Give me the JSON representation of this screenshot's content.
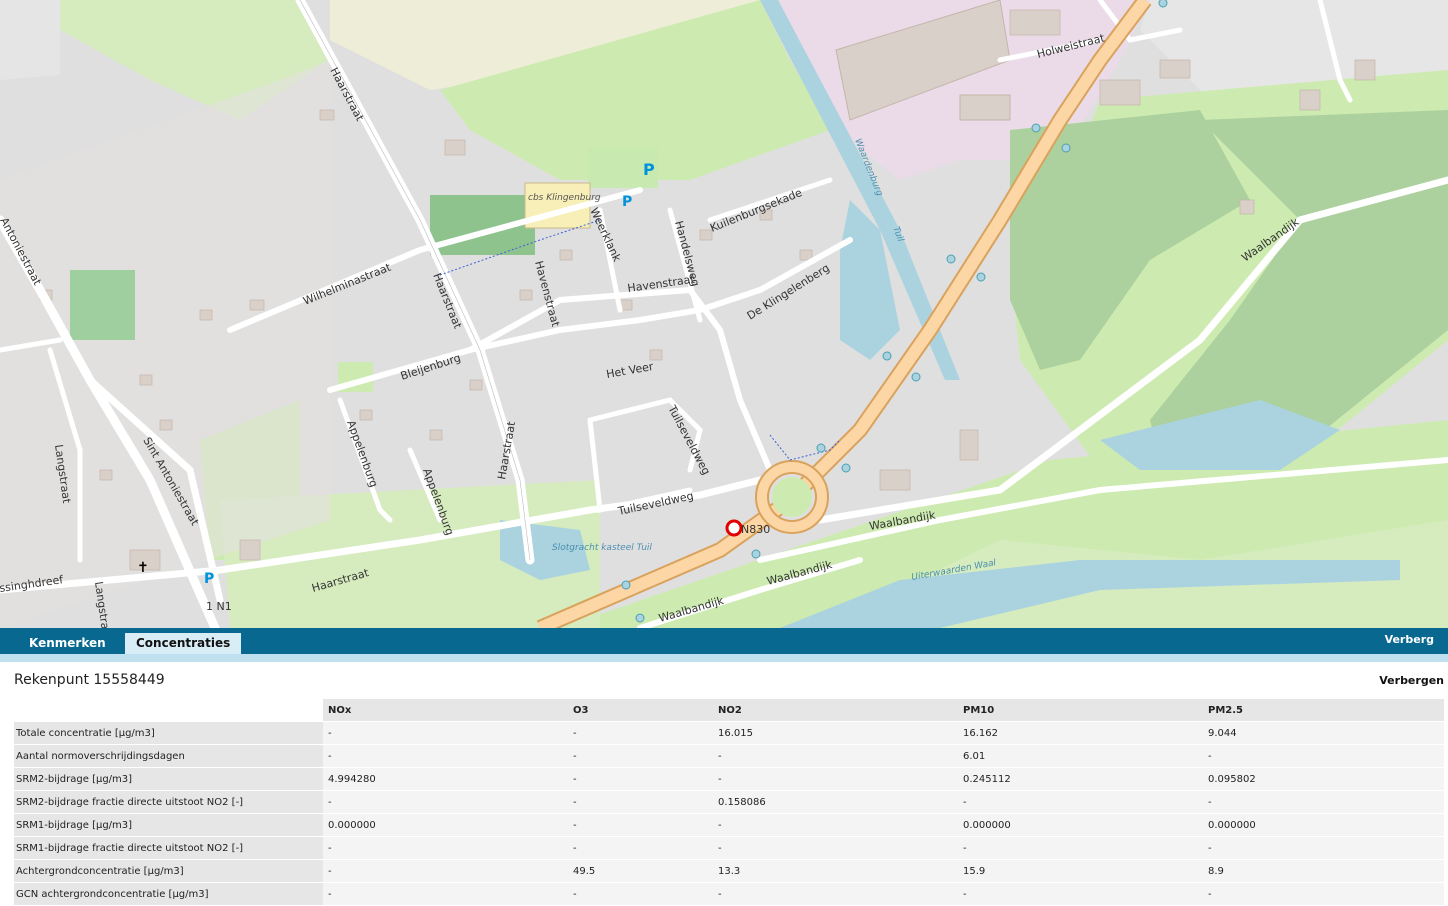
{
  "map": {
    "labels": {
      "haarstraat": "Haarstraat",
      "wilhelminastraat": "Wilhelminastraat",
      "havenstraat_v": "Havenstraat",
      "havenstraat_h": "Havenstraat",
      "bleijenburg": "Bleijenburg",
      "appelenburg1": "Appelenburg",
      "appelenburg2": "Appelenburg",
      "het_veer": "Het Veer",
      "tuilseveldweg1": "Tuilseveldweg",
      "tuilseveldweg2": "Tuilseveldweg",
      "kuilenburgsekade": "Kuilenburgsekade",
      "de_klingelenberg": "De Klingelenberg",
      "handelsweg": "Handelsweg",
      "weerklank": "Weerklank",
      "waalbandijk1": "Waalbandijk",
      "waalbandijk2": "Waalbandijk",
      "waalbandijk3": "Waalbandijk",
      "waalbandijk4": "Waalbandijk",
      "holweistraat": "Holweistraat",
      "sint_antoniestraat": "Sint Antoniestraat",
      "antoniestraat": "Antoniestraat",
      "langstraat": "Langstraat",
      "langstraat2": "Langstraat",
      "singhdreef": "ssinghdreef",
      "school": "cbs Klingenburg",
      "slotgracht": "Slotgracht kasteel Tuil",
      "uiterwaarden": "Uiterwaarden Waal",
      "waardenburg": "Waardenburg",
      "tuil": "Tuil",
      "road_n830": "N830",
      "road_n1": "1 N1",
      "parking": "P"
    }
  },
  "tabs": [
    {
      "label": "Kenmerken"
    },
    {
      "label": "Concentraties"
    }
  ],
  "toolbar": {
    "hide_label": "Verberg"
  },
  "panel": {
    "title": "Rekenpunt 15558449",
    "hide_label": "Verbergen",
    "columns": [
      "NOx",
      "O3",
      "NO2",
      "PM10",
      "PM2.5"
    ],
    "rows": [
      {
        "label": "Totale concentratie [µg/m3]",
        "values": [
          "-",
          "-",
          "16.015",
          "16.162",
          "9.044"
        ]
      },
      {
        "label": "Aantal normoverschrijdingsdagen",
        "values": [
          "-",
          "-",
          "-",
          "6.01",
          "-"
        ]
      },
      {
        "label": "SRM2-bijdrage [µg/m3]",
        "values": [
          "4.994280",
          "-",
          "-",
          "0.245112",
          "0.095802"
        ]
      },
      {
        "label": "SRM2-bijdrage fractie directe uitstoot NO2 [-]",
        "values": [
          "-",
          "-",
          "0.158086",
          "-",
          "-"
        ]
      },
      {
        "label": "SRM1-bijdrage [µg/m3]",
        "values": [
          "0.000000",
          "-",
          "-",
          "0.000000",
          "0.000000"
        ]
      },
      {
        "label": "SRM1-bijdrage fractie directe uitstoot NO2 [-]",
        "values": [
          "-",
          "-",
          "-",
          "-",
          "-"
        ]
      },
      {
        "label": "Achtergrondconcentratie [µg/m3]",
        "values": [
          "-",
          "49.5",
          "13.3",
          "15.9",
          "8.9"
        ]
      },
      {
        "label": "GCN achtergrondconcentratie [µg/m3]",
        "values": [
          "-",
          "-",
          "-",
          "-",
          "-"
        ]
      }
    ]
  }
}
